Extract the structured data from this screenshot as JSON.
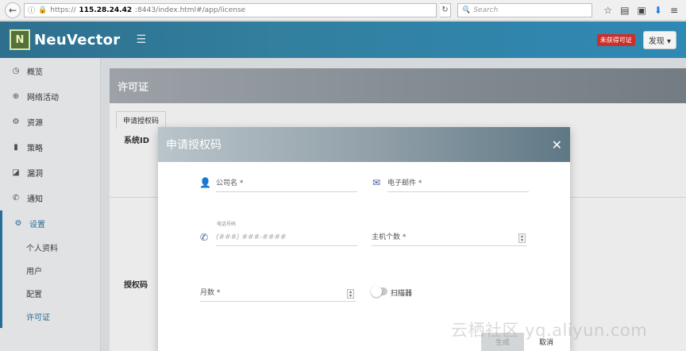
{
  "browser": {
    "url_scheme": "https://",
    "url_host": "115.28.24.42",
    "url_rest": ":8443/index.html#/app/license",
    "search_placeholder": "Search"
  },
  "header": {
    "logo_glyph": "N",
    "brand": "NeuVector",
    "unlicensed_badge": "未获得可证",
    "discover_button": "发现 ▾"
  },
  "sidebar": {
    "items": [
      {
        "label": "概览",
        "icon": "◷"
      },
      {
        "label": "网络活动",
        "icon": "⊕"
      },
      {
        "label": "资源",
        "icon": "⚙"
      },
      {
        "label": "策略",
        "icon": "▮"
      },
      {
        "label": "漏洞",
        "icon": "◪"
      },
      {
        "label": "通知",
        "icon": "✆"
      },
      {
        "label": "设置",
        "icon": "⚙"
      }
    ],
    "sub_items": [
      {
        "label": "个人资料"
      },
      {
        "label": "用户"
      },
      {
        "label": "配置"
      },
      {
        "label": "许可证"
      }
    ]
  },
  "main": {
    "page_title": "许可证",
    "tab_label": "申请授权码",
    "system_id_label": "系统ID",
    "auth_code_label": "授权码"
  },
  "modal": {
    "title": "申请授权码",
    "close": "✕",
    "company_label": "公司名 *",
    "email_label": "电子邮件 *",
    "phone_float_label": "电话号码",
    "phone_placeholder": "(###) ###-####",
    "hosts_label": "主机个数 *",
    "months_label": "月数 *",
    "scanner_label": "扫描器",
    "generate_button": "生成",
    "cancel_button": "取消"
  },
  "watermark": "云栖社区 yq.aliyun.com"
}
